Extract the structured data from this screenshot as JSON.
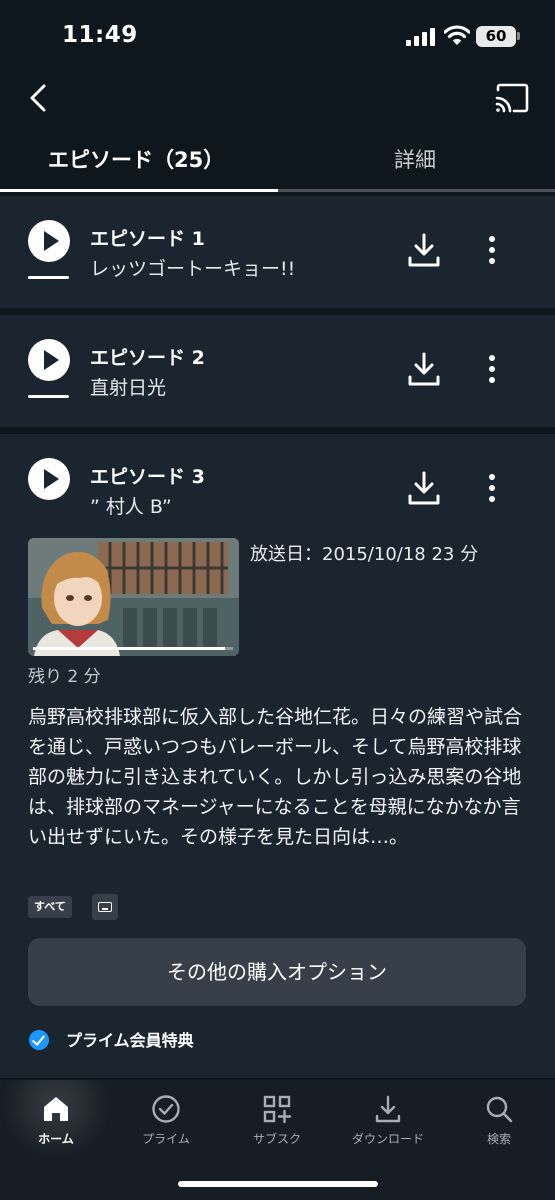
{
  "status_bar": {
    "time": "11:49",
    "battery": "60"
  },
  "header": {
    "back_icon": "back-chevron-icon",
    "cast_icon": "cast-icon"
  },
  "tabs": [
    {
      "label": "エピソード（25）",
      "active": true
    },
    {
      "label": "詳細",
      "active": false
    }
  ],
  "episodes": [
    {
      "title": "エピソード 1",
      "subtitle": "レッツゴートーキョー!!"
    },
    {
      "title": "エピソード 2",
      "subtitle": "直射日光"
    },
    {
      "title": "エピソード 3",
      "subtitle": "” 村人 B”",
      "air_date": "放送日：2015/10/18 23 分",
      "remaining": "残り 2 分",
      "progress": 0.96,
      "synopsis": "烏野高校排球部に仮入部した谷地仁花。日々の練習や試合を通じ、戸惑いつつもバレーボール、そして烏野高校排球部の魅力に引き込まれていく。しかし引っ込み思案の谷地は、排球部のマネージャーになることを母親になかなか言い出せずにいた。その様子を見た日向は…。",
      "badge": "すべて",
      "purchase_button": "その他の購入オプション",
      "prime_label": "プライム会員特典"
    }
  ],
  "bottom_nav": [
    {
      "label": "ホーム",
      "icon": "home-icon",
      "active": true
    },
    {
      "label": "プライム",
      "icon": "check-circle-icon",
      "active": false
    },
    {
      "label": "サブスク",
      "icon": "grid-plus-icon",
      "active": false
    },
    {
      "label": "ダウンロード",
      "icon": "download-icon",
      "active": false
    },
    {
      "label": "検索",
      "icon": "search-icon",
      "active": false
    }
  ],
  "colors": {
    "background": "#0f171e",
    "card": "#1b2530",
    "accent": "#1a98ff"
  }
}
